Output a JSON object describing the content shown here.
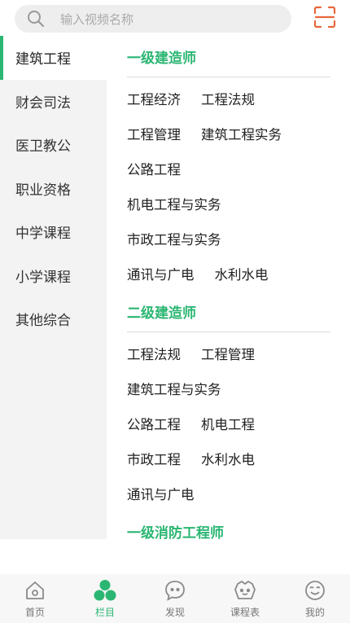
{
  "search": {
    "placeholder": "输入视频名称"
  },
  "sidebar": {
    "items": [
      {
        "label": "建筑工程",
        "active": true
      },
      {
        "label": "财会司法"
      },
      {
        "label": "医卫教公"
      },
      {
        "label": "职业资格"
      },
      {
        "label": "中学课程"
      },
      {
        "label": "小学课程"
      },
      {
        "label": "其他综合"
      }
    ]
  },
  "content": {
    "sections": [
      {
        "title": "一级建造师",
        "rows": [
          [
            "工程经济",
            "工程法规"
          ],
          [
            "工程管理",
            "建筑工程实务"
          ],
          [
            "公路工程"
          ],
          [
            "机电工程与实务"
          ],
          [
            "市政工程与实务"
          ],
          [
            "通讯与广电",
            "水利水电"
          ]
        ]
      },
      {
        "title": "二级建造师",
        "rows": [
          [
            "工程法规",
            "工程管理"
          ],
          [
            "建筑工程与实务"
          ],
          [
            "公路工程",
            "机电工程"
          ],
          [
            "市政工程",
            "水利水电"
          ],
          [
            "通讯与广电"
          ]
        ]
      },
      {
        "title": "一级消防工程师",
        "rows": []
      }
    ]
  },
  "bottom_nav": {
    "tabs": [
      {
        "label": "首页",
        "icon": "home-icon"
      },
      {
        "label": "栏目",
        "icon": "category-icon",
        "active": true
      },
      {
        "label": "发现",
        "icon": "discover-chat-icon"
      },
      {
        "label": "课程表",
        "icon": "schedule-icon"
      },
      {
        "label": "我的",
        "icon": "profile-icon"
      }
    ]
  },
  "colors": {
    "accent": "#2bb673",
    "scan_icon": "#e8663b"
  }
}
